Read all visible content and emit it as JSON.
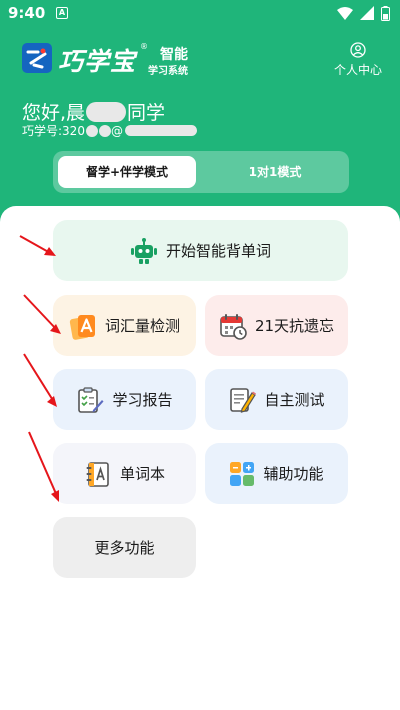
{
  "status_bar": {
    "time": "9:40",
    "app_icon": "A"
  },
  "top_bar": {
    "logo_text": "巧学宝",
    "logo_reg": "®",
    "logo_line1": "智能",
    "logo_line2": "学习系统",
    "profile_label": "个人中心"
  },
  "greeting": {
    "hello": "您好,晨",
    "suffix": "同学",
    "account_label": "巧学号:320",
    "account_mid": "@"
  },
  "mode_tabs": {
    "active": "督学+伴学模式",
    "inactive": "1对1模式"
  },
  "cards": {
    "start": "开始智能背单词",
    "vocab_test": "词汇量检测",
    "anti_forget": "21天抗遗忘",
    "report": "学习报告",
    "self_test": "自主测试",
    "wordbook": "单词本",
    "aux": "辅助功能",
    "more": "更多功能"
  },
  "colors": {
    "header_green": "#1fb57a",
    "card_green": "#e8f7ef",
    "card_orange": "#fdf3e4",
    "card_red": "#fdeceb",
    "card_blue": "#eaf2fc",
    "card_gray": "#eeeeee",
    "annotation_red": "#e5161b"
  },
  "icons": {
    "robot": "robot-icon",
    "vocab": "vocabulary-card-icon",
    "calendar": "calendar-clock-icon",
    "report": "report-clipboard-icon",
    "test": "pencil-test-icon",
    "book": "notebook-icon",
    "aux": "apps-grid-icon",
    "profile": "user-profile-icon"
  }
}
